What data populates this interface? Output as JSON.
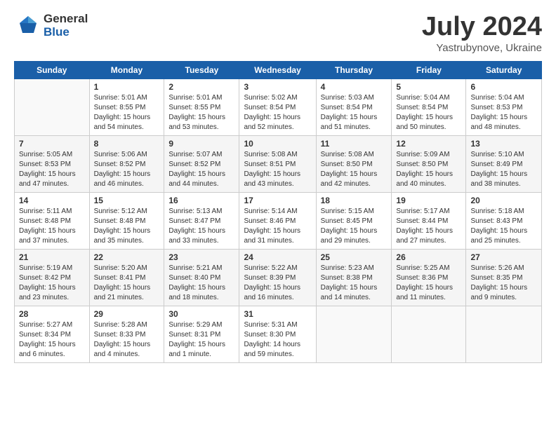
{
  "header": {
    "logo_general": "General",
    "logo_blue": "Blue",
    "title": "July 2024",
    "location": "Yastrubynove, Ukraine"
  },
  "columns": [
    "Sunday",
    "Monday",
    "Tuesday",
    "Wednesday",
    "Thursday",
    "Friday",
    "Saturday"
  ],
  "weeks": [
    [
      {
        "day": "",
        "text": ""
      },
      {
        "day": "1",
        "text": "Sunrise: 5:01 AM\nSunset: 8:55 PM\nDaylight: 15 hours\nand 54 minutes."
      },
      {
        "day": "2",
        "text": "Sunrise: 5:01 AM\nSunset: 8:55 PM\nDaylight: 15 hours\nand 53 minutes."
      },
      {
        "day": "3",
        "text": "Sunrise: 5:02 AM\nSunset: 8:54 PM\nDaylight: 15 hours\nand 52 minutes."
      },
      {
        "day": "4",
        "text": "Sunrise: 5:03 AM\nSunset: 8:54 PM\nDaylight: 15 hours\nand 51 minutes."
      },
      {
        "day": "5",
        "text": "Sunrise: 5:04 AM\nSunset: 8:54 PM\nDaylight: 15 hours\nand 50 minutes."
      },
      {
        "day": "6",
        "text": "Sunrise: 5:04 AM\nSunset: 8:53 PM\nDaylight: 15 hours\nand 48 minutes."
      }
    ],
    [
      {
        "day": "7",
        "text": "Sunrise: 5:05 AM\nSunset: 8:53 PM\nDaylight: 15 hours\nand 47 minutes."
      },
      {
        "day": "8",
        "text": "Sunrise: 5:06 AM\nSunset: 8:52 PM\nDaylight: 15 hours\nand 46 minutes."
      },
      {
        "day": "9",
        "text": "Sunrise: 5:07 AM\nSunset: 8:52 PM\nDaylight: 15 hours\nand 44 minutes."
      },
      {
        "day": "10",
        "text": "Sunrise: 5:08 AM\nSunset: 8:51 PM\nDaylight: 15 hours\nand 43 minutes."
      },
      {
        "day": "11",
        "text": "Sunrise: 5:08 AM\nSunset: 8:50 PM\nDaylight: 15 hours\nand 42 minutes."
      },
      {
        "day": "12",
        "text": "Sunrise: 5:09 AM\nSunset: 8:50 PM\nDaylight: 15 hours\nand 40 minutes."
      },
      {
        "day": "13",
        "text": "Sunrise: 5:10 AM\nSunset: 8:49 PM\nDaylight: 15 hours\nand 38 minutes."
      }
    ],
    [
      {
        "day": "14",
        "text": "Sunrise: 5:11 AM\nSunset: 8:48 PM\nDaylight: 15 hours\nand 37 minutes."
      },
      {
        "day": "15",
        "text": "Sunrise: 5:12 AM\nSunset: 8:48 PM\nDaylight: 15 hours\nand 35 minutes."
      },
      {
        "day": "16",
        "text": "Sunrise: 5:13 AM\nSunset: 8:47 PM\nDaylight: 15 hours\nand 33 minutes."
      },
      {
        "day": "17",
        "text": "Sunrise: 5:14 AM\nSunset: 8:46 PM\nDaylight: 15 hours\nand 31 minutes."
      },
      {
        "day": "18",
        "text": "Sunrise: 5:15 AM\nSunset: 8:45 PM\nDaylight: 15 hours\nand 29 minutes."
      },
      {
        "day": "19",
        "text": "Sunrise: 5:17 AM\nSunset: 8:44 PM\nDaylight: 15 hours\nand 27 minutes."
      },
      {
        "day": "20",
        "text": "Sunrise: 5:18 AM\nSunset: 8:43 PM\nDaylight: 15 hours\nand 25 minutes."
      }
    ],
    [
      {
        "day": "21",
        "text": "Sunrise: 5:19 AM\nSunset: 8:42 PM\nDaylight: 15 hours\nand 23 minutes."
      },
      {
        "day": "22",
        "text": "Sunrise: 5:20 AM\nSunset: 8:41 PM\nDaylight: 15 hours\nand 21 minutes."
      },
      {
        "day": "23",
        "text": "Sunrise: 5:21 AM\nSunset: 8:40 PM\nDaylight: 15 hours\nand 18 minutes."
      },
      {
        "day": "24",
        "text": "Sunrise: 5:22 AM\nSunset: 8:39 PM\nDaylight: 15 hours\nand 16 minutes."
      },
      {
        "day": "25",
        "text": "Sunrise: 5:23 AM\nSunset: 8:38 PM\nDaylight: 15 hours\nand 14 minutes."
      },
      {
        "day": "26",
        "text": "Sunrise: 5:25 AM\nSunset: 8:36 PM\nDaylight: 15 hours\nand 11 minutes."
      },
      {
        "day": "27",
        "text": "Sunrise: 5:26 AM\nSunset: 8:35 PM\nDaylight: 15 hours\nand 9 minutes."
      }
    ],
    [
      {
        "day": "28",
        "text": "Sunrise: 5:27 AM\nSunset: 8:34 PM\nDaylight: 15 hours\nand 6 minutes."
      },
      {
        "day": "29",
        "text": "Sunrise: 5:28 AM\nSunset: 8:33 PM\nDaylight: 15 hours\nand 4 minutes."
      },
      {
        "day": "30",
        "text": "Sunrise: 5:29 AM\nSunset: 8:31 PM\nDaylight: 15 hours\nand 1 minute."
      },
      {
        "day": "31",
        "text": "Sunrise: 5:31 AM\nSunset: 8:30 PM\nDaylight: 14 hours\nand 59 minutes."
      },
      {
        "day": "",
        "text": ""
      },
      {
        "day": "",
        "text": ""
      },
      {
        "day": "",
        "text": ""
      }
    ]
  ]
}
